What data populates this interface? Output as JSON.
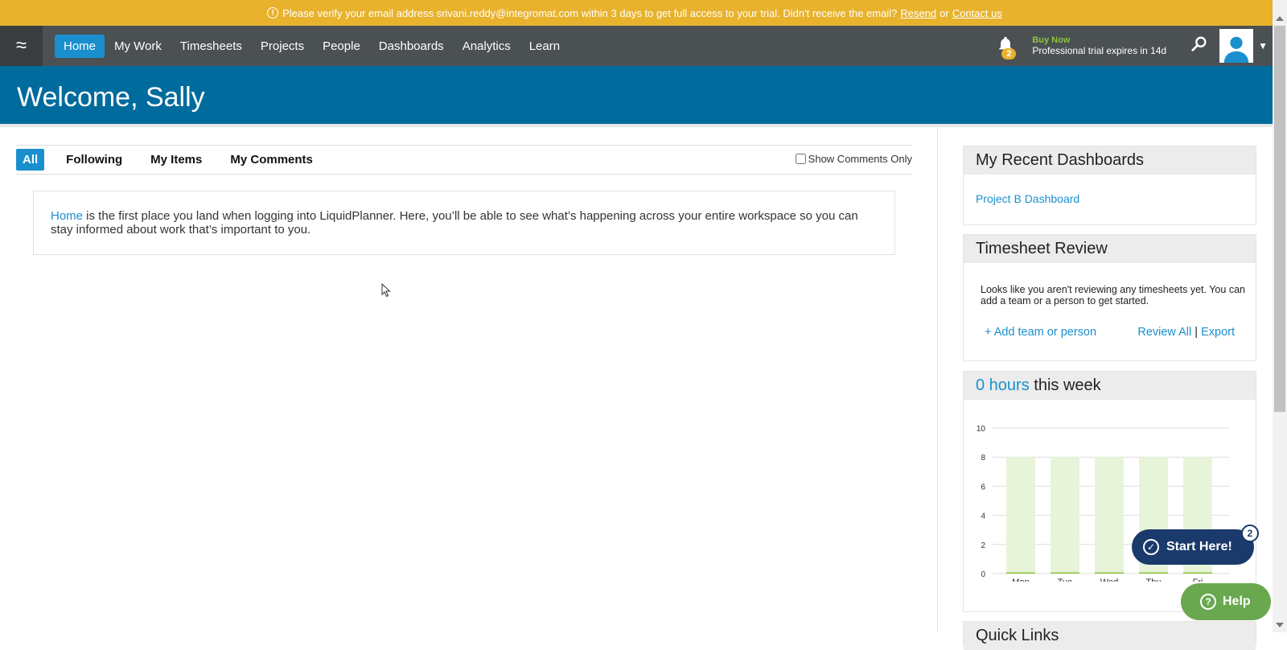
{
  "banner": {
    "message": "Please verify your email address srivani.reddy@integromat.com within 3 days to get full access to your trial. Didn't receive the email?",
    "resend": "Resend",
    "or": "or",
    "contact": "Contact us"
  },
  "nav": {
    "items": [
      "Home",
      "My Work",
      "Timesheets",
      "Projects",
      "People",
      "Dashboards",
      "Analytics",
      "Learn"
    ],
    "notifications_count": "2",
    "buy_now": "Buy Now",
    "trial_text": "Professional trial expires in 14d"
  },
  "header": {
    "title": "Welcome, Sally"
  },
  "feed": {
    "tabs": [
      "All",
      "Following",
      "My Items",
      "My Comments"
    ],
    "show_comments_label": "Show Comments Only",
    "info_link": "Home",
    "info_text": " is the first place you land when logging into LiquidPlanner. Here, you’ll be able to see what’s happening across your entire workspace so you can stay informed about work that’s important to you."
  },
  "recent_dashboards": {
    "title": "My Recent Dashboards",
    "items": [
      "Project B Dashboard"
    ]
  },
  "timesheet_review": {
    "title": "Timesheet Review",
    "message": "Looks like you aren't reviewing any timesheets yet. You can add a team or a person to get started.",
    "add_label": "+ Add team or person",
    "review_all": "Review All",
    "separator": "|",
    "export": "Export"
  },
  "hours": {
    "value": "0 hours",
    "suffix": " this week"
  },
  "chart_data": {
    "type": "bar",
    "categories": [
      "Mon",
      "Tue",
      "Wed",
      "Thu",
      "Fri"
    ],
    "series": [
      {
        "values": [
          8,
          8,
          8,
          8,
          8
        ]
      },
      {
        "values": [
          0,
          0,
          0,
          0,
          0
        ]
      }
    ],
    "ylim": [
      0,
      10
    ],
    "yticks": [
      0,
      2,
      4,
      6,
      8,
      10
    ],
    "colors": {
      "capacity": "#e8f4d9",
      "logged": "#8dc63f",
      "grid": "#dddddd"
    }
  },
  "next_panel": {
    "title": "Quick Links"
  },
  "floating": {
    "start_here": "Start Here!",
    "start_badge": "2",
    "help": "Help"
  },
  "colors": {
    "accent": "#1b8fce",
    "banner": "#e8b22d",
    "nav": "#4b5053",
    "header": "#006b9d"
  }
}
